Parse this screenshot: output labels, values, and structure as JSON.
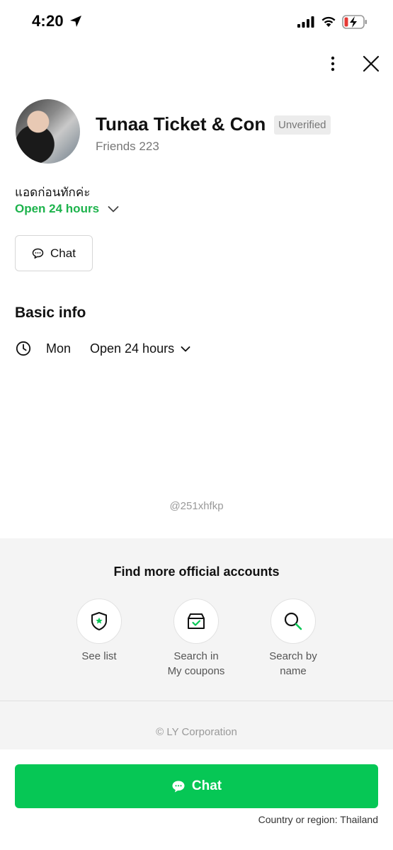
{
  "status_bar": {
    "time": "4:20"
  },
  "profile": {
    "name": "Tunaa Ticket & Con",
    "badge": "Unverified",
    "friends": "Friends 223",
    "status_message": "แอดก่อนทักค่ะ",
    "hours": "Open 24 hours",
    "chat_button": "Chat"
  },
  "basic_info": {
    "title": "Basic info",
    "day": "Mon",
    "hours": "Open 24 hours"
  },
  "account_id": "@251xhfkp",
  "find_more": {
    "title": "Find more official accounts",
    "items": [
      {
        "label_line1": "See list",
        "label_line2": "",
        "icon": "shield-star-icon"
      },
      {
        "label_line1": "Search in",
        "label_line2": "My coupons",
        "icon": "coupon-box-icon"
      },
      {
        "label_line1": "Search by",
        "label_line2": "name",
        "icon": "search-icon"
      }
    ]
  },
  "footer": {
    "copyright": "© LY Corporation",
    "chat_button": "Chat",
    "region": "Country or region: Thailand"
  },
  "colors": {
    "accent_green": "#06c755",
    "hours_green": "#1db34c"
  }
}
